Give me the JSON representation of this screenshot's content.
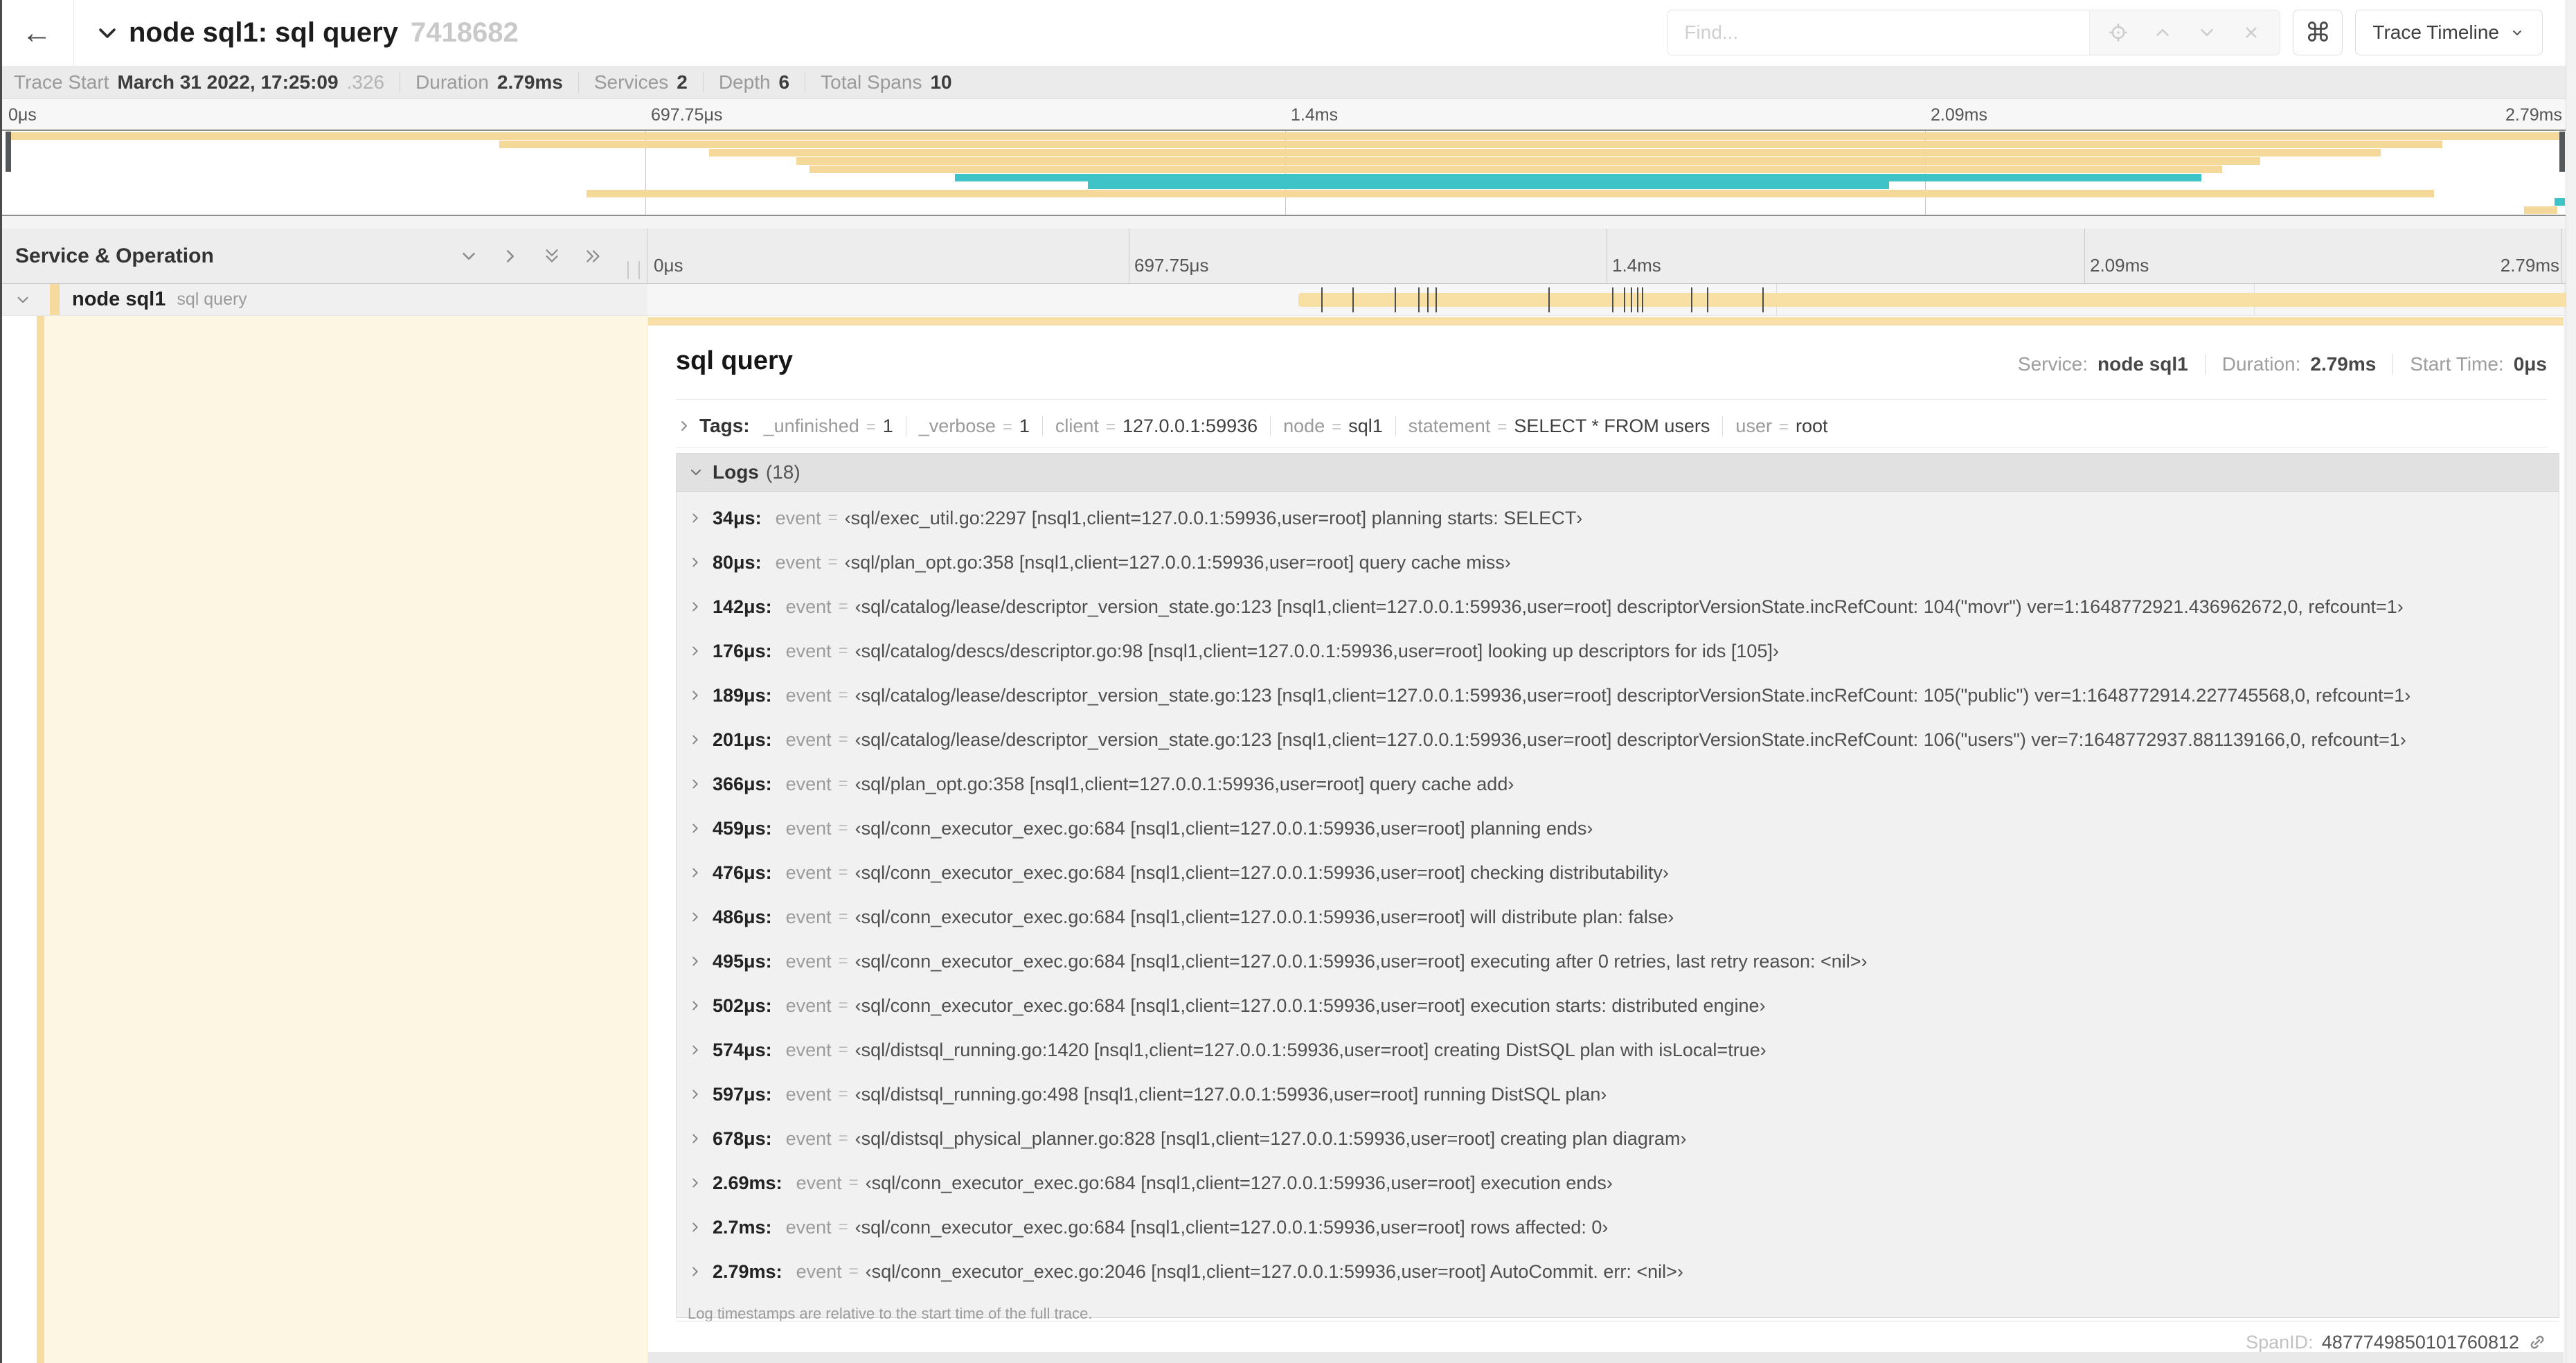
{
  "colors": {
    "tan": "#F4D99A",
    "teal": "#3EC4C6",
    "span_bar": "#F8DFA4",
    "detail_background": "#FDF6E3"
  },
  "header": {
    "back_glyph": "←",
    "title": "node sql1: sql query",
    "trace_id": "7418682",
    "find_placeholder": "Find...",
    "shortcut_glyph": "⌘",
    "view_selector_label": "Trace Timeline"
  },
  "summary": {
    "items": [
      {
        "label": "Trace Start",
        "value": "March 31 2022, 17:25:09",
        "suffix": ".326"
      },
      {
        "label": "Duration",
        "value": "2.79ms"
      },
      {
        "label": "Services",
        "value": "2"
      },
      {
        "label": "Depth",
        "value": "6"
      },
      {
        "label": "Total Spans",
        "value": "10"
      }
    ]
  },
  "timeline": {
    "tick_labels": [
      "0μs",
      "697.75μs",
      "1.4ms",
      "2.09ms",
      "2.79ms"
    ],
    "duration_us": 2790,
    "minimap_spans": [
      {
        "row": 0,
        "start": 0,
        "end": 100,
        "color": "tan"
      },
      {
        "row": 1,
        "start": 19.3,
        "end": 95.2,
        "color": "tan"
      },
      {
        "row": 2,
        "start": 27.5,
        "end": 92.8,
        "color": "tan"
      },
      {
        "row": 3,
        "start": 30.9,
        "end": 88.1,
        "color": "tan"
      },
      {
        "row": 4,
        "start": 31.4,
        "end": 86.6,
        "color": "tan"
      },
      {
        "row": 5,
        "start": 37.1,
        "end": 85.8,
        "color": "teal"
      },
      {
        "row": 6,
        "start": 42.3,
        "end": 73.6,
        "color": "teal"
      },
      {
        "row": 7,
        "start": 22.7,
        "end": 94.9,
        "color": "tan"
      },
      {
        "row": 8,
        "start": 99.6,
        "end": 100,
        "color": "teal"
      },
      {
        "row": 9,
        "start": 98.4,
        "end": 99.7,
        "color": "tan"
      }
    ],
    "log_marker_fractions": [
      1.22,
      2.87,
      5.09,
      6.31,
      6.77,
      7.2,
      13.12,
      16.45,
      17.06,
      17.42,
      17.74,
      17.99,
      20.57,
      21.4,
      24.3,
      96.42,
      96.77,
      99.9
    ]
  },
  "table": {
    "left_header": "Service & Operation"
  },
  "span_row": {
    "service": "node sql1",
    "operation": "sql query"
  },
  "detail": {
    "operation_title": "sql query",
    "service_label": "Service:",
    "service_value": "node sql1",
    "duration_label": "Duration:",
    "duration_value": "2.79ms",
    "start_time_label": "Start Time:",
    "start_time_value": "0μs",
    "tags_label": "Tags:",
    "tags": [
      {
        "key": "_unfinished",
        "value": "1"
      },
      {
        "key": "_verbose",
        "value": "1"
      },
      {
        "key": "client",
        "value": "127.0.0.1:59936"
      },
      {
        "key": "node",
        "value": "sql1"
      },
      {
        "key": "statement",
        "value": "SELECT * FROM users"
      },
      {
        "key": "user",
        "value": "root"
      }
    ],
    "logs_label": "Logs",
    "logs_count": "(18)",
    "logs": [
      {
        "time": "34μs:",
        "key": "event",
        "value": "‹sql/exec_util.go:2297 [nsql1,client=127.0.0.1:59936,user=root] planning starts: SELECT›"
      },
      {
        "time": "80μs:",
        "key": "event",
        "value": "‹sql/plan_opt.go:358 [nsql1,client=127.0.0.1:59936,user=root] query cache miss›"
      },
      {
        "time": "142μs:",
        "key": "event",
        "value": "‹sql/catalog/lease/descriptor_version_state.go:123 [nsql1,client=127.0.0.1:59936,user=root] descriptorVersionState.incRefCount: 104(\"movr\") ver=1:1648772921.436962672,0, refcount=1›"
      },
      {
        "time": "176μs:",
        "key": "event",
        "value": "‹sql/catalog/descs/descriptor.go:98 [nsql1,client=127.0.0.1:59936,user=root] looking up descriptors for ids [105]›"
      },
      {
        "time": "189μs:",
        "key": "event",
        "value": "‹sql/catalog/lease/descriptor_version_state.go:123 [nsql1,client=127.0.0.1:59936,user=root] descriptorVersionState.incRefCount: 105(\"public\") ver=1:1648772914.227745568,0, refcount=1›"
      },
      {
        "time": "201μs:",
        "key": "event",
        "value": "‹sql/catalog/lease/descriptor_version_state.go:123 [nsql1,client=127.0.0.1:59936,user=root] descriptorVersionState.incRefCount: 106(\"users\") ver=7:1648772937.881139166,0, refcount=1›"
      },
      {
        "time": "366μs:",
        "key": "event",
        "value": "‹sql/plan_opt.go:358 [nsql1,client=127.0.0.1:59936,user=root] query cache add›"
      },
      {
        "time": "459μs:",
        "key": "event",
        "value": "‹sql/conn_executor_exec.go:684 [nsql1,client=127.0.0.1:59936,user=root] planning ends›"
      },
      {
        "time": "476μs:",
        "key": "event",
        "value": "‹sql/conn_executor_exec.go:684 [nsql1,client=127.0.0.1:59936,user=root] checking distributability›"
      },
      {
        "time": "486μs:",
        "key": "event",
        "value": "‹sql/conn_executor_exec.go:684 [nsql1,client=127.0.0.1:59936,user=root] will distribute plan: false›"
      },
      {
        "time": "495μs:",
        "key": "event",
        "value": "‹sql/conn_executor_exec.go:684 [nsql1,client=127.0.0.1:59936,user=root] executing after 0 retries, last retry reason: <nil>›"
      },
      {
        "time": "502μs:",
        "key": "event",
        "value": "‹sql/conn_executor_exec.go:684 [nsql1,client=127.0.0.1:59936,user=root] execution starts: distributed engine›"
      },
      {
        "time": "574μs:",
        "key": "event",
        "value": "‹sql/distsql_running.go:1420 [nsql1,client=127.0.0.1:59936,user=root] creating DistSQL plan with isLocal=true›"
      },
      {
        "time": "597μs:",
        "key": "event",
        "value": "‹sql/distsql_running.go:498 [nsql1,client=127.0.0.1:59936,user=root] running DistSQL plan›"
      },
      {
        "time": "678μs:",
        "key": "event",
        "value": "‹sql/distsql_physical_planner.go:828 [nsql1,client=127.0.0.1:59936,user=root] creating plan diagram›"
      },
      {
        "time": "2.69ms:",
        "key": "event",
        "value": "‹sql/conn_executor_exec.go:684 [nsql1,client=127.0.0.1:59936,user=root] execution ends›"
      },
      {
        "time": "2.7ms:",
        "key": "event",
        "value": "‹sql/conn_executor_exec.go:684 [nsql1,client=127.0.0.1:59936,user=root] rows affected: 0›"
      },
      {
        "time": "2.79ms:",
        "key": "event",
        "value": "‹sql/conn_executor_exec.go:2046 [nsql1,client=127.0.0.1:59936,user=root] AutoCommit. err: <nil>›"
      }
    ],
    "logs_note": "Log timestamps are relative to the start time of the full trace.",
    "span_id_label": "SpanID:",
    "span_id_value": "4877749850101760812"
  }
}
